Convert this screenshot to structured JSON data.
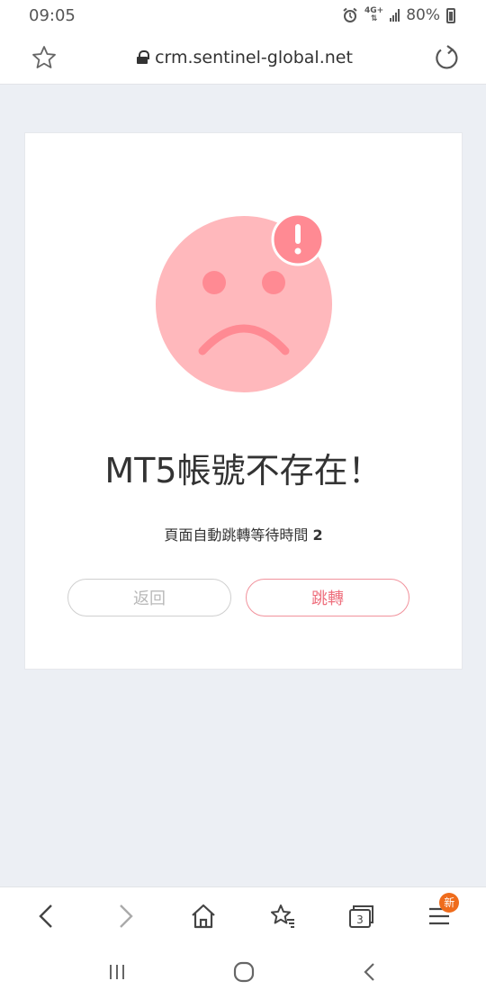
{
  "status_bar": {
    "time": "09:05",
    "network": "4G+",
    "battery": "80%",
    "icons": [
      "alarm-icon",
      "network-icon",
      "signal-icon",
      "battery-icon"
    ]
  },
  "browser": {
    "url": "crm.sentinel-global.net",
    "icons": [
      "star-icon",
      "lock-icon",
      "reload-icon"
    ]
  },
  "card": {
    "title": "MT5帳號不存在！",
    "countdown_label": "頁面自動跳轉等待時間",
    "countdown_value": "2",
    "back_label": "返回",
    "jump_label": "跳轉",
    "face_color": "#ffb8bc",
    "alert_color": "#ff8a93"
  },
  "bottom_nav": {
    "tabs_count": "3",
    "badge": "新",
    "icons": [
      "back-icon",
      "forward-icon",
      "home-icon",
      "bookmarks-icon",
      "tabs-icon",
      "menu-icon"
    ]
  },
  "system_nav": {
    "icons": [
      "recents-icon",
      "home-circle-icon",
      "back-chevron-icon"
    ]
  }
}
